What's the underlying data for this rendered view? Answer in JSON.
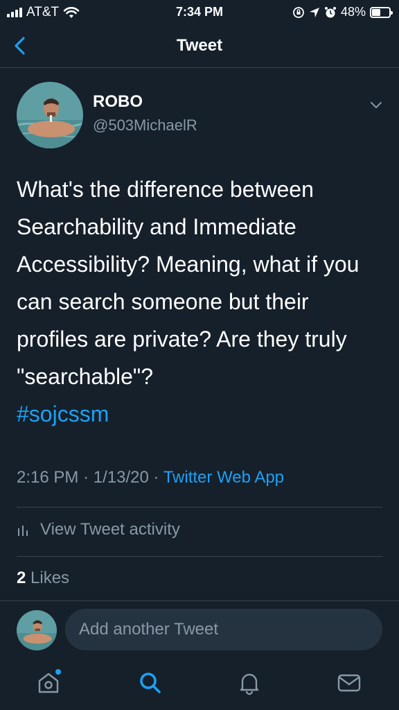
{
  "status_bar": {
    "carrier": "AT&T",
    "time": "7:34 PM",
    "battery_percent": "48%",
    "battery_level": 0.48,
    "icons": [
      "signal-icon",
      "wifi-icon",
      "orientation-lock-icon",
      "location-icon",
      "alarm-icon",
      "battery-icon"
    ]
  },
  "nav": {
    "title": "Tweet",
    "back_icon": "chevron-left-icon"
  },
  "tweet": {
    "author_name": "ROBO",
    "author_handle": "@503MichaelR",
    "text": "What's the difference between Searchability and Immediate Accessibility? Meaning, what if you can search someone but their profiles are private? Are they truly \"searchable\"?",
    "hashtag": "#sojcssm",
    "time": "2:16 PM",
    "date": "1/13/20",
    "separator": "·",
    "source": "Twitter Web App",
    "activity_label": "View Tweet activity",
    "likes_count": "2",
    "likes_label": "Likes"
  },
  "reply": {
    "placeholder": "Add another Tweet"
  },
  "tab_bar": {
    "tabs": [
      "home-icon",
      "search-icon",
      "notifications-icon",
      "messages-icon"
    ],
    "active_color": "#1da1f2"
  },
  "colors": {
    "background": "#15202b",
    "accent": "#1da1f2",
    "secondary_text": "#8899a6",
    "divider": "#38444d"
  }
}
